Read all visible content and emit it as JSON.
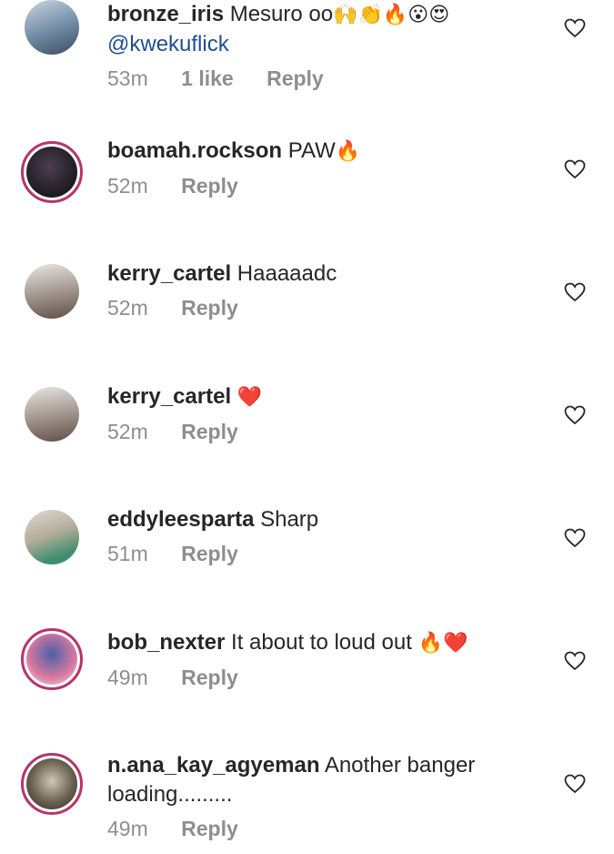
{
  "comments": [
    {
      "username": "bronze_iris",
      "text": "Mesuro oo",
      "emojis": "🙌👏🔥😮😍",
      "mention": "@kwekuflick",
      "time": "53m",
      "likes": "1 like",
      "reply": "Reply",
      "avatar_color": "#7a9bb4"
    },
    {
      "username": "boamah.rockson",
      "text": "PAW",
      "emojis": "🔥",
      "time": "52m",
      "reply": "Reply",
      "avatar_color": "#3b2f3a"
    },
    {
      "username": "kerry_cartel",
      "text": "Haaaaadc",
      "time": "52m",
      "reply": "Reply",
      "avatar_color": "#8a7f7a"
    },
    {
      "username": "kerry_cartel",
      "text": "",
      "emojis": "❤️",
      "time": "52m",
      "reply": "Reply",
      "avatar_color": "#8a7f7a"
    },
    {
      "username": "eddyleesparta",
      "text": "Sharp",
      "time": "51m",
      "reply": "Reply",
      "avatar_color": "#b8b4a8"
    },
    {
      "username": "bob_nexter",
      "text": "It about to loud out",
      "emojis": "🔥❤️",
      "time": "49m",
      "reply": "Reply",
      "avatar_color": "#5b6aa3"
    },
    {
      "username": "n.ana_kay_agyeman",
      "text": "Another banger loading.........",
      "time": "49m",
      "reply": "Reply",
      "avatar_color": "#6b6152"
    }
  ],
  "colors": {
    "text": "#262626",
    "meta": "#8e8e8e",
    "mention": "#1d4f91",
    "story_ring": "#b8336a"
  },
  "icons": {
    "like": "heart-outline-icon"
  }
}
